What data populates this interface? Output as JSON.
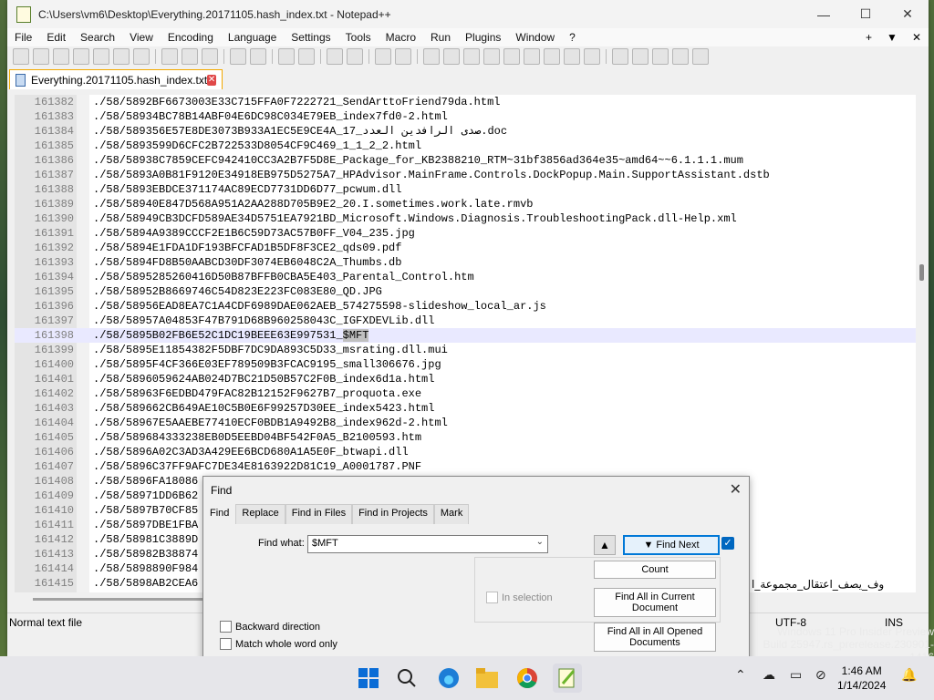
{
  "window": {
    "title": "C:\\Users\\vm6\\Desktop\\Everything.20171105.hash_index.txt - Notepad++"
  },
  "menu": {
    "items": [
      "File",
      "Edit",
      "Search",
      "View",
      "Encoding",
      "Language",
      "Settings",
      "Tools",
      "Macro",
      "Run",
      "Plugins",
      "Window",
      "?"
    ],
    "right": [
      "+",
      "▼",
      "✕"
    ]
  },
  "tab": {
    "label": "Everything.20171105.hash_index.txt"
  },
  "editor": {
    "lines": [
      {
        "n": "161382",
        "t": "./58/5892BF6673003E33C715FFA0F7222721_SendArttoFriend79da.html"
      },
      {
        "n": "161383",
        "t": "./58/58934BC78B14ABF04E6DC98C034E79EB_index7fd0-2.html"
      },
      {
        "n": "161384",
        "t": "./58/589356E57E8DE3073B933A1EC5E9CE4A_17_صدى الرافدين العدد.doc"
      },
      {
        "n": "161385",
        "t": "./58/5893599D6CFC2B722533D8054CF9C469_1_1_2_2.html"
      },
      {
        "n": "161386",
        "t": "./58/58938C7859CEFC942410CC3A2B7F5D8E_Package_for_KB2388210_RTM~31bf3856ad364e35~amd64~~6.1.1.1.mum"
      },
      {
        "n": "161387",
        "t": "./58/5893A0B81F9120E34918EB975D5275A7_HPAdvisor.MainFrame.Controls.DockPopup.Main.SupportAssistant.dstb"
      },
      {
        "n": "161388",
        "t": "./58/5893EBDCE371174AC89ECD7731DD6D77_pcwum.dll"
      },
      {
        "n": "161389",
        "t": "./58/58940E847D568A951A2AA288D705B9E2_20.I.sometimes.work.late.rmvb"
      },
      {
        "n": "161390",
        "t": "./58/58949CB3DCFD589AE34D5751EA7921BD_Microsoft.Windows.Diagnosis.TroubleshootingPack.dll-Help.xml"
      },
      {
        "n": "161391",
        "t": "./58/5894A9389CCCF2E1B6C59D73AC57B0FF_V04_235.jpg"
      },
      {
        "n": "161392",
        "t": "./58/5894E1FDA1DF193BFCFAD1B5DF8F3CE2_qds09.pdf"
      },
      {
        "n": "161393",
        "t": "./58/5894FD8B50AABCD30DF3074EB6048C2A_Thumbs.db"
      },
      {
        "n": "161394",
        "t": "./58/5895285260416D50B87BFFB0CBA5E403_Parental_Control.htm"
      },
      {
        "n": "161395",
        "t": "./58/58952B8669746C54D823E223FC083E80_QD.JPG"
      },
      {
        "n": "161396",
        "t": "./58/58956EAD8EA7C1A4CDF6989DAE062AEB_574275598-slideshow_local_ar.js"
      },
      {
        "n": "161397",
        "t": "./58/58957A04853F47B791D68B960258043C_IGFXDEVLib.dll"
      },
      {
        "n": "161398",
        "t": "./58/5895B02FB6E52C1DC19BEEE63E997531_",
        "hl": "$MFT",
        "current": true
      },
      {
        "n": "161399",
        "t": "./58/5895E11854382F5DBF7DC9DA893C5D33_msrating.dll.mui"
      },
      {
        "n": "161400",
        "t": "./58/5895F4CF366E03EF789509B3FCAC9195_small306676.jpg"
      },
      {
        "n": "161401",
        "t": "./58/5896059624AB024D7BC21D50B57C2F0B_index6d1a.html"
      },
      {
        "n": "161402",
        "t": "./58/58963F6EDBD479FAC82B12152F9627B7_proquota.exe"
      },
      {
        "n": "161403",
        "t": "./58/589662CB649AE10C5B0E6F99257D30EE_index5423.html"
      },
      {
        "n": "161404",
        "t": "./58/58967E5AAEBE77410ECF0BDB1A9492B8_index962d-2.html"
      },
      {
        "n": "161405",
        "t": "./58/589684333238EB0D5EEBD04BF542F0A5_B2100593.htm"
      },
      {
        "n": "161406",
        "t": "./58/5896A02C3AD3A429EE6BCD680A1A5E0F_btwapi.dll"
      },
      {
        "n": "161407",
        "t": "./58/5896C37FF9AFC7DE34E8163922D81C19_A0001787.PNF"
      },
      {
        "n": "161408",
        "t": "./58/5896FA18086"
      },
      {
        "n": "161409",
        "t": "./58/58971DD6B62"
      },
      {
        "n": "161410",
        "t": "./58/5897B70CF85"
      },
      {
        "n": "161411",
        "t": "./58/5897DBE1FBA"
      },
      {
        "n": "161412",
        "t": "./58/58981C3889D"
      },
      {
        "n": "161413",
        "t": "./58/58982B38874"
      },
      {
        "n": "161414",
        "t": "./58/5898890F984"
      },
      {
        "n": "161415",
        "t": "./58/5898AB2CEA6"
      }
    ],
    "arabic_fragment": "وف_يصف_اعتقال_مجموعة_ا"
  },
  "status": {
    "left": "Normal text file",
    "encoding": "UTF-8",
    "mode": "INS"
  },
  "find": {
    "title": "Find",
    "tabs": [
      "Find",
      "Replace",
      "Find in Files",
      "Find in Projects",
      "Mark"
    ],
    "find_what_label": "Find what:",
    "find_what_value": "$MFT",
    "find_next": "▼ Find Next",
    "up_arrow": "▲",
    "count": "Count",
    "find_all_current": "Find All in Current Document",
    "find_all_opened": "Find All in All Opened Documents",
    "in_selection": "In selection",
    "backward": "Backward direction",
    "whole_word": "Match whole word only"
  },
  "watermark": {
    "line1": "Windows 11 Pro Insider Preview",
    "line2": "Build 25947.rs_prerelease.230901-1416"
  },
  "clock": {
    "time": "1:46 AM",
    "date": "1/14/2024"
  },
  "colors": {
    "accent": "#0078d7",
    "tab_border": "#f2a900",
    "current_line": "#e9e9ff"
  }
}
